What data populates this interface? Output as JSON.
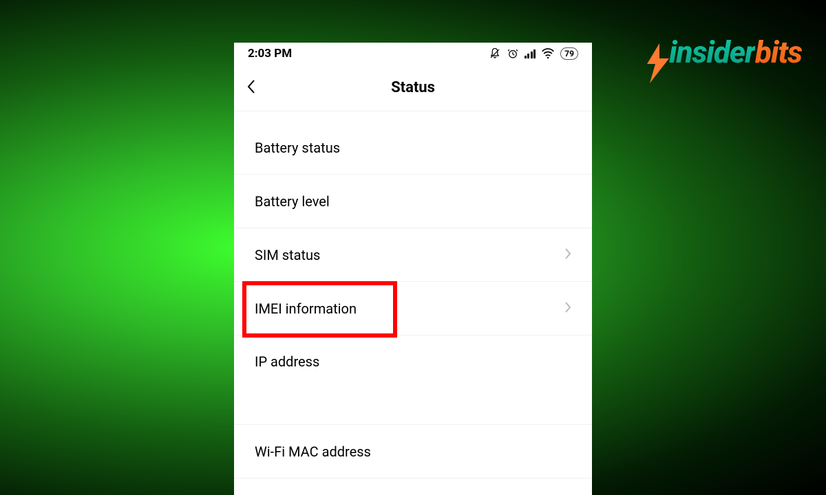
{
  "logo": {
    "part1": "insider",
    "part2": "bits"
  },
  "statusBar": {
    "time": "2:03 PM",
    "battery": "79"
  },
  "header": {
    "title": "Status"
  },
  "items": [
    {
      "label": "Battery status",
      "chevron": false
    },
    {
      "label": "Battery level",
      "chevron": false
    },
    {
      "label": "SIM status",
      "chevron": true
    },
    {
      "label": "IMEI information",
      "chevron": true,
      "highlighted": true
    },
    {
      "label": "IP address",
      "chevron": false,
      "tall": true
    },
    {
      "label": "Wi-Fi MAC address",
      "chevron": false
    }
  ]
}
